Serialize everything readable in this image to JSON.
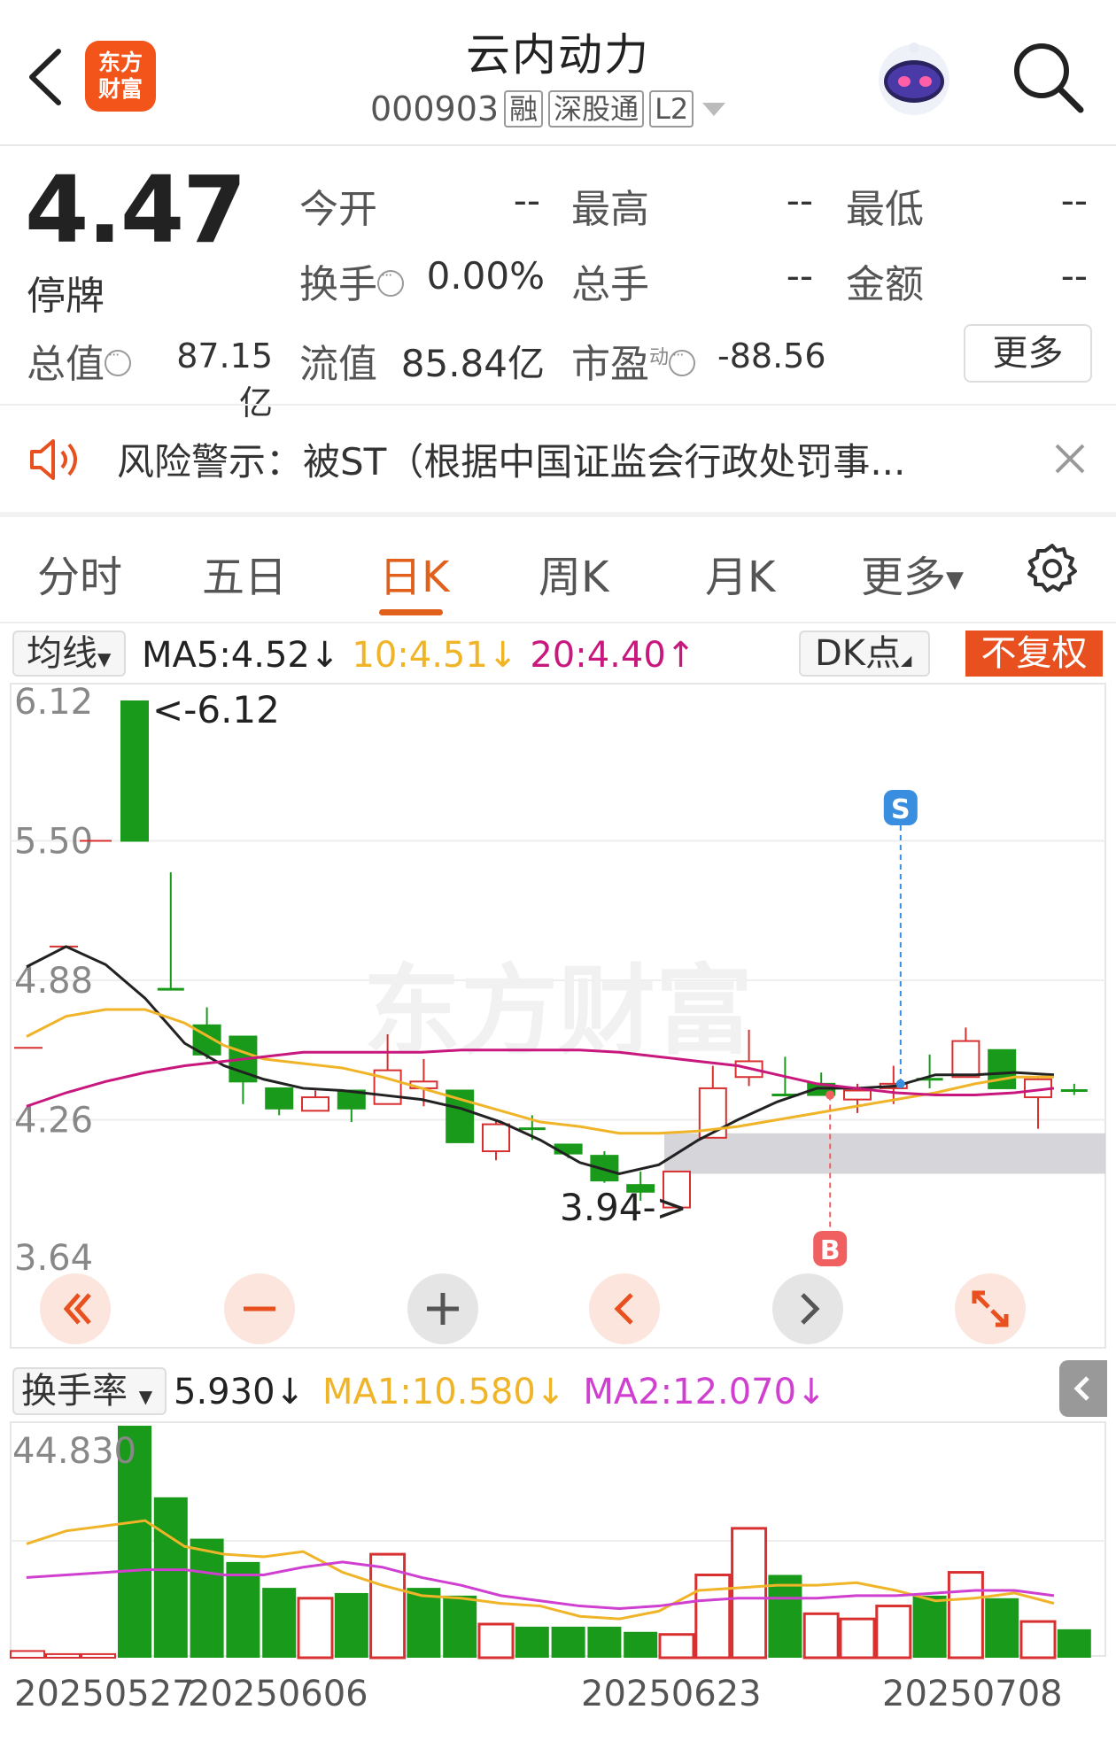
{
  "header": {
    "title": "云内动力",
    "code": "000903",
    "tags": [
      "融",
      "深股通",
      "L2"
    ],
    "logo_text_1": "东方",
    "logo_text_2": "财富"
  },
  "quote": {
    "price": "4.47",
    "status": "停牌",
    "open_label": "今开",
    "open_value": "--",
    "high_label": "最高",
    "high_value": "--",
    "low_label": "最低",
    "low_value": "--",
    "turnover_label": "换手",
    "turnover_value": "0.00%",
    "volume_label": "总手",
    "volume_value": "--",
    "amount_label": "金额",
    "amount_value": "--",
    "mktcap_label": "总值",
    "mktcap_value": "87.15亿",
    "float_label": "流值",
    "float_value": "85.84亿",
    "pe_label": "市盈",
    "pe_sup": "动",
    "pe_value": "-88.56",
    "more_label": "更多"
  },
  "warning": {
    "text": "风险警示：被ST（根据中国证监会行政处罚事..."
  },
  "tabs": [
    {
      "label": "分时"
    },
    {
      "label": "五日"
    },
    {
      "label": "日K"
    },
    {
      "label": "周K"
    },
    {
      "label": "月K"
    },
    {
      "label": "更多"
    }
  ],
  "active_tab": "日K",
  "ma_row": {
    "selector": "均线",
    "ma5": "MA5:4.52",
    "ma10": "10:4.51",
    "ma20": "20:4.40",
    "dk": "DK点",
    "adjust": "不复权"
  },
  "turnover_row": {
    "selector": "换手率",
    "value": "5.930",
    "ma1": "MA1:10.580",
    "ma2": "MA2:12.070"
  },
  "colors": {
    "up": "#d83030",
    "down": "#1a9a1a",
    "ma5": "#222222",
    "ma10": "#f0b428",
    "ma20": "#c8187e",
    "accent": "#e0601c"
  },
  "chart_data": {
    "type": "candlestick",
    "y_ticks": [
      "6.12",
      "5.50",
      "4.88",
      "4.26",
      "3.64"
    ],
    "ylim": [
      3.64,
      6.12
    ],
    "annotations": {
      "high_label": "<-6.12",
      "low_label": "3.94->",
      "sell_marker": "S",
      "buy_marker": "B"
    },
    "x_labels": [
      "20250527",
      "20250606",
      "20250623",
      "20250708"
    ],
    "candles": [
      {
        "o": 6.12,
        "c": 5.5,
        "h": 6.12,
        "l": 5.5
      },
      {
        "o": 4.84,
        "c": 4.84,
        "h": 5.36,
        "l": 4.84
      },
      {
        "o": 4.68,
        "c": 4.55,
        "h": 4.76,
        "l": 4.53
      },
      {
        "o": 4.63,
        "c": 4.43,
        "h": 4.63,
        "l": 4.33
      },
      {
        "o": 4.4,
        "c": 4.31,
        "h": 4.4,
        "l": 4.28
      },
      {
        "o": 4.3,
        "c": 4.36,
        "h": 4.39,
        "l": 4.3
      },
      {
        "o": 4.39,
        "c": 4.31,
        "h": 4.39,
        "l": 4.25
      },
      {
        "o": 4.33,
        "c": 4.48,
        "h": 4.64,
        "l": 4.33
      },
      {
        "o": 4.4,
        "c": 4.43,
        "h": 4.53,
        "l": 4.32
      },
      {
        "o": 4.39,
        "c": 4.16,
        "h": 4.39,
        "l": 4.16
      },
      {
        "o": 4.12,
        "c": 4.24,
        "h": 4.26,
        "l": 4.08
      },
      {
        "o": 4.22,
        "c": 4.22,
        "h": 4.28,
        "l": 4.17
      },
      {
        "o": 4.15,
        "c": 4.11,
        "h": 4.15,
        "l": 4.09
      },
      {
        "o": 4.1,
        "c": 3.99,
        "h": 4.12,
        "l": 3.98
      },
      {
        "o": 3.97,
        "c": 3.94,
        "h": 4.03,
        "l": 3.9
      },
      {
        "o": 3.87,
        "c": 4.03,
        "h": 4.03,
        "l": 3.87
      },
      {
        "o": 4.18,
        "c": 4.4,
        "h": 4.5,
        "l": 4.18
      },
      {
        "o": 4.45,
        "c": 4.52,
        "h": 4.66,
        "l": 4.41
      },
      {
        "o": 4.37,
        "c": 4.37,
        "h": 4.54,
        "l": 4.37
      },
      {
        "o": 4.42,
        "c": 4.37,
        "h": 4.47,
        "l": 4.37
      },
      {
        "o": 4.35,
        "c": 4.39,
        "h": 4.42,
        "l": 4.29
      },
      {
        "o": 4.4,
        "c": 4.42,
        "h": 4.5,
        "l": 4.33
      },
      {
        "o": 4.44,
        "c": 4.44,
        "h": 4.55,
        "l": 4.4
      },
      {
        "o": 4.45,
        "c": 4.61,
        "h": 4.67,
        "l": 4.45
      },
      {
        "o": 4.57,
        "c": 4.4,
        "h": 4.57,
        "l": 4.4
      },
      {
        "o": 4.36,
        "c": 4.44,
        "h": 4.45,
        "l": 4.22
      },
      {
        "o": 4.39,
        "c": 4.39,
        "h": 4.42,
        "l": 4.37
      }
    ],
    "ma5": [
      4.94,
      5.03,
      4.95,
      4.8,
      4.6,
      4.5,
      4.44,
      4.4,
      4.39,
      4.37,
      4.35,
      4.31,
      4.25,
      4.17,
      4.07,
      4.02,
      4.06,
      4.17,
      4.26,
      4.34,
      4.4,
      4.4,
      4.41,
      4.46,
      4.46,
      4.47,
      4.46
    ],
    "ma10": [
      4.63,
      4.72,
      4.75,
      4.75,
      4.69,
      4.59,
      4.53,
      4.51,
      4.49,
      4.45,
      4.4,
      4.35,
      4.3,
      4.25,
      4.23,
      4.2,
      4.2,
      4.21,
      4.23,
      4.26,
      4.29,
      4.32,
      4.35,
      4.38,
      4.42,
      4.45,
      4.45
    ],
    "ma20": [
      4.32,
      4.38,
      4.43,
      4.47,
      4.5,
      4.52,
      4.54,
      4.56,
      4.56,
      4.56,
      4.56,
      4.57,
      4.57,
      4.57,
      4.57,
      4.56,
      4.54,
      4.52,
      4.5,
      4.46,
      4.42,
      4.4,
      4.38,
      4.37,
      4.37,
      4.38,
      4.4
    ],
    "gap_band": [
      4.02,
      4.2
    ],
    "turnover": {
      "y_tick": "44.830",
      "ylim": [
        0,
        44.83
      ],
      "bars": [
        {
          "v": 44.83,
          "up": false
        },
        {
          "v": 31.0,
          "up": false
        },
        {
          "v": 23.0,
          "up": false
        },
        {
          "v": 18.5,
          "up": false
        },
        {
          "v": 13.5,
          "up": false
        },
        {
          "v": 11.5,
          "up": true
        },
        {
          "v": 12.5,
          "up": false
        },
        {
          "v": 20.0,
          "up": true
        },
        {
          "v": 13.5,
          "up": false
        },
        {
          "v": 12.0,
          "up": false
        },
        {
          "v": 6.5,
          "up": true
        },
        {
          "v": 6.0,
          "up": false
        },
        {
          "v": 6.0,
          "up": false
        },
        {
          "v": 6.0,
          "up": false
        },
        {
          "v": 5.0,
          "up": false
        },
        {
          "v": 4.5,
          "up": true
        },
        {
          "v": 16.0,
          "up": true
        },
        {
          "v": 25.0,
          "up": true
        },
        {
          "v": 16.0,
          "up": false
        },
        {
          "v": 8.5,
          "up": true
        },
        {
          "v": 7.5,
          "up": true
        },
        {
          "v": 10.0,
          "up": true
        },
        {
          "v": 12.0,
          "up": false
        },
        {
          "v": 16.5,
          "up": true
        },
        {
          "v": 11.5,
          "up": false
        },
        {
          "v": 7.0,
          "up": true
        },
        {
          "v": 5.5,
          "up": false
        }
      ],
      "ma1": [
        22.0,
        24.5,
        25.5,
        26.5,
        21.5,
        20.0,
        19.5,
        20.5,
        16.5,
        14.0,
        12.0,
        11.5,
        10.5,
        10.0,
        8.0,
        7.5,
        9.0,
        13.0,
        13.5,
        14.0,
        14.0,
        14.5,
        13.0,
        11.0,
        11.5,
        12.5,
        10.5
      ],
      "ma2": [
        15.5,
        16.0,
        16.5,
        17.0,
        17.0,
        16.0,
        16.0,
        17.5,
        18.5,
        17.5,
        15.5,
        14.0,
        12.0,
        11.0,
        10.0,
        9.5,
        10.0,
        11.0,
        11.5,
        11.5,
        11.5,
        12.0,
        12.0,
        12.5,
        13.0,
        13.0,
        12.0
      ]
    }
  }
}
